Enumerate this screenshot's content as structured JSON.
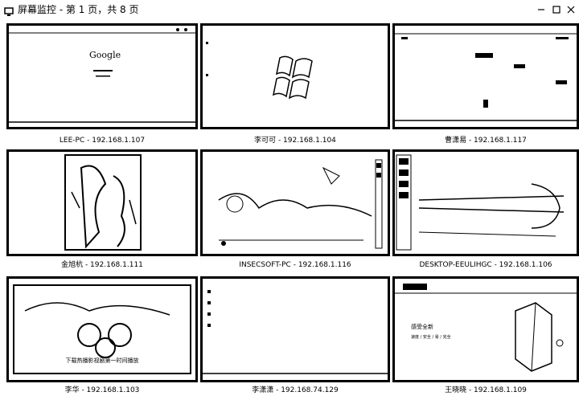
{
  "window": {
    "title": "屏幕监控 - 第 1 页，共 8 页",
    "icon": "monitor-icon",
    "buttons": [
      "minimize-icon",
      "maximize-icon",
      "close-icon"
    ]
  },
  "screens": [
    {
      "caption": "LEE-PC - 192.168.1.107",
      "content": "google-search",
      "google_logo": "Google"
    },
    {
      "caption": "李可可 - 192.168.1.104",
      "content": "windows-logo"
    },
    {
      "caption": "曹潇易 - 192.168.1.117",
      "content": "baidu-home"
    },
    {
      "caption": "金旭杭 - 192.168.1.111",
      "content": "poster-image"
    },
    {
      "caption": "INSECSOFT-PC - 192.168.1.116",
      "content": "desktop-wallpaper"
    },
    {
      "caption": "DESKTOP-EEULIHGC - 192.168.1.106",
      "content": "architecture-photo"
    },
    {
      "caption": "李华 - 192.168.1.103",
      "content": "cartoon-image",
      "banner_text": "下载热播影视剧第一时间播放"
    },
    {
      "caption": "李潇潇 - 192.168.74.129",
      "content": "blank-desktop"
    },
    {
      "caption": "王晓晓 - 192.168.1.109",
      "content": "win10-promo",
      "promo_title": "感受全新",
      "promo_sub": "速度 / 安全 / 易 / 完全"
    }
  ]
}
